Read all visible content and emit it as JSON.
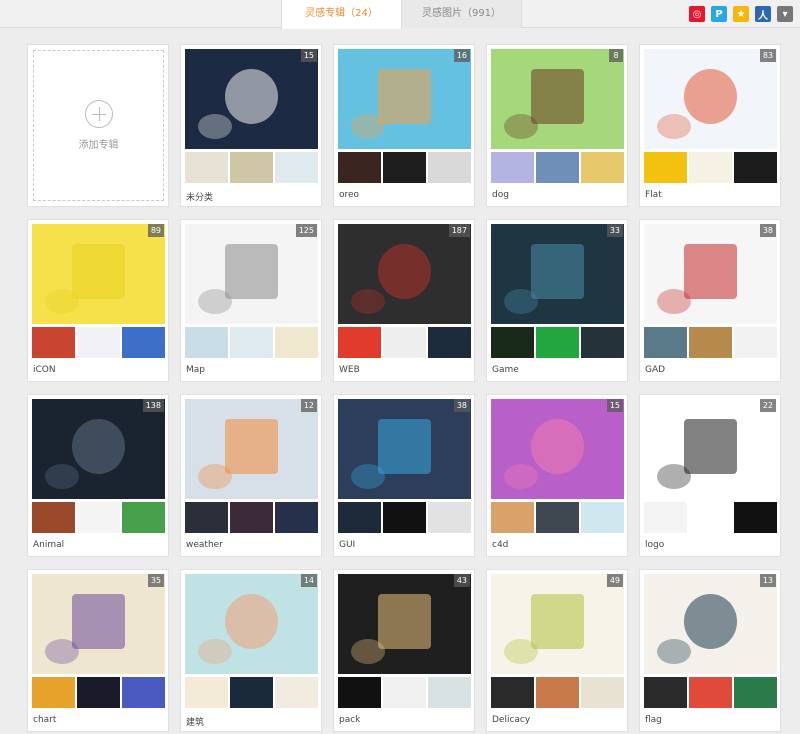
{
  "tabs": [
    {
      "label": "灵感专辑（24）",
      "active": true
    },
    {
      "label": "灵感图片（991）",
      "active": false
    }
  ],
  "share_icons": [
    {
      "name": "weibo-icon",
      "glyph": "◎",
      "color": "#e6162d"
    },
    {
      "name": "qzone-icon",
      "glyph": "P",
      "color": "#29a6e6"
    },
    {
      "name": "favorite-star-icon",
      "glyph": "★",
      "color": "#f6b60c"
    },
    {
      "name": "renren-icon",
      "glyph": "人",
      "color": "#2e67b1"
    },
    {
      "name": "more-dropdown-icon",
      "glyph": "▾",
      "color": "#777777"
    }
  ],
  "add_album": {
    "label": "添加专辑"
  },
  "albums": [
    {
      "label": "未分类",
      "count": "15",
      "main": "#1d2a44",
      "accent": "#f2f2f2",
      "thumbs": [
        "#e7e2d4",
        "#cfc6a6",
        "#dfe9ee"
      ]
    },
    {
      "label": "oreo",
      "count": "16",
      "main": "#64c2e0",
      "accent": "#f0a04a",
      "thumbs": [
        "#3b2520",
        "#1e1e1e",
        "#d9d9d9"
      ]
    },
    {
      "label": "dog",
      "count": "8",
      "main": "#a5d87a",
      "accent": "#6a3b20",
      "thumbs": [
        "#b3b4e2",
        "#6f8fb8",
        "#e7c86a"
      ]
    },
    {
      "label": "Flat",
      "count": "83",
      "main": "#f2f6fb",
      "accent": "#e25a3a",
      "thumbs": [
        "#f2c20f",
        "#f5f2e3",
        "#1c1c1c"
      ]
    },
    {
      "label": "iCON",
      "count": "89",
      "main": "#f5e24a",
      "accent": "#e8cf22",
      "thumbs": [
        "#c9452f",
        "#f1f1f6",
        "#3c6fc8"
      ]
    },
    {
      "label": "Map",
      "count": "125",
      "main": "#f4f4f4",
      "accent": "#8a8a8a",
      "thumbs": [
        "#c8dde7",
        "#dfe9f0",
        "#f0e7cf"
      ]
    },
    {
      "label": "WEB",
      "count": "187",
      "main": "#2e2e2e",
      "accent": "#b2322a",
      "thumbs": [
        "#e03b2d",
        "#eeeeee",
        "#1c2c3c"
      ]
    },
    {
      "label": "Game",
      "count": "33",
      "main": "#1e3642",
      "accent": "#4a8aa8",
      "thumbs": [
        "#1a2a1a",
        "#22a640",
        "#26323a"
      ]
    },
    {
      "label": "GAD",
      "count": "38",
      "main": "#f6f6f6",
      "accent": "#c22a2a",
      "thumbs": [
        "#5a7a8a",
        "#b58a4a",
        "#f2f2f2"
      ]
    },
    {
      "label": "Animal",
      "count": "138",
      "main": "#1a2430",
      "accent": "#5d6e82",
      "thumbs": [
        "#9a4a2a",
        "#f4f4f4",
        "#46a04a"
      ]
    },
    {
      "label": "weather",
      "count": "12",
      "main": "#d7dfe9",
      "accent": "#f28a3a",
      "thumbs": [
        "#2a2f3a",
        "#3a2a3a",
        "#26304a"
      ]
    },
    {
      "label": "GUI",
      "count": "38",
      "main": "#2c3e5a",
      "accent": "#3aa8e0",
      "thumbs": [
        "#1e2a3a",
        "#111111",
        "#e2e2e2"
      ]
    },
    {
      "label": "c4d",
      "count": "15",
      "main": "#b860c8",
      "accent": "#f07ab2",
      "thumbs": [
        "#d9a26a",
        "#3e4650",
        "#cfe7ee"
      ]
    },
    {
      "label": "logo",
      "count": "22",
      "main": "#ffffff",
      "accent": "#1b1b1b",
      "thumbs": [
        "#f4f4f4",
        "#ffffff",
        "#111111"
      ]
    },
    {
      "label": "chart",
      "count": "35",
      "main": "#efe6d0",
      "accent": "#6a4a9a",
      "thumbs": [
        "#e6a22a",
        "#1a1a2a",
        "#4a5ac0"
      ]
    },
    {
      "label": "建筑",
      "count": "14",
      "main": "#bfe2e4",
      "accent": "#f2a07a",
      "thumbs": [
        "#f4ead8",
        "#1a2a3a",
        "#f2ece0"
      ]
    },
    {
      "label": "pack",
      "count": "43",
      "main": "#1f1f1f",
      "accent": "#e8c07a",
      "thumbs": [
        "#111111",
        "#f0f0f0",
        "#d8e2e2"
      ]
    },
    {
      "label": "Delicacy",
      "count": "49",
      "main": "#f6f4e8",
      "accent": "#b0c23a",
      "thumbs": [
        "#2a2a2a",
        "#c87a4a",
        "#e8e2d2"
      ]
    },
    {
      "label": "flag",
      "count": "13",
      "main": "#f4f1ea",
      "accent": "#1b3a4a",
      "thumbs": [
        "#2a2a2a",
        "#e04a3a",
        "#2a7a4a"
      ]
    }
  ]
}
